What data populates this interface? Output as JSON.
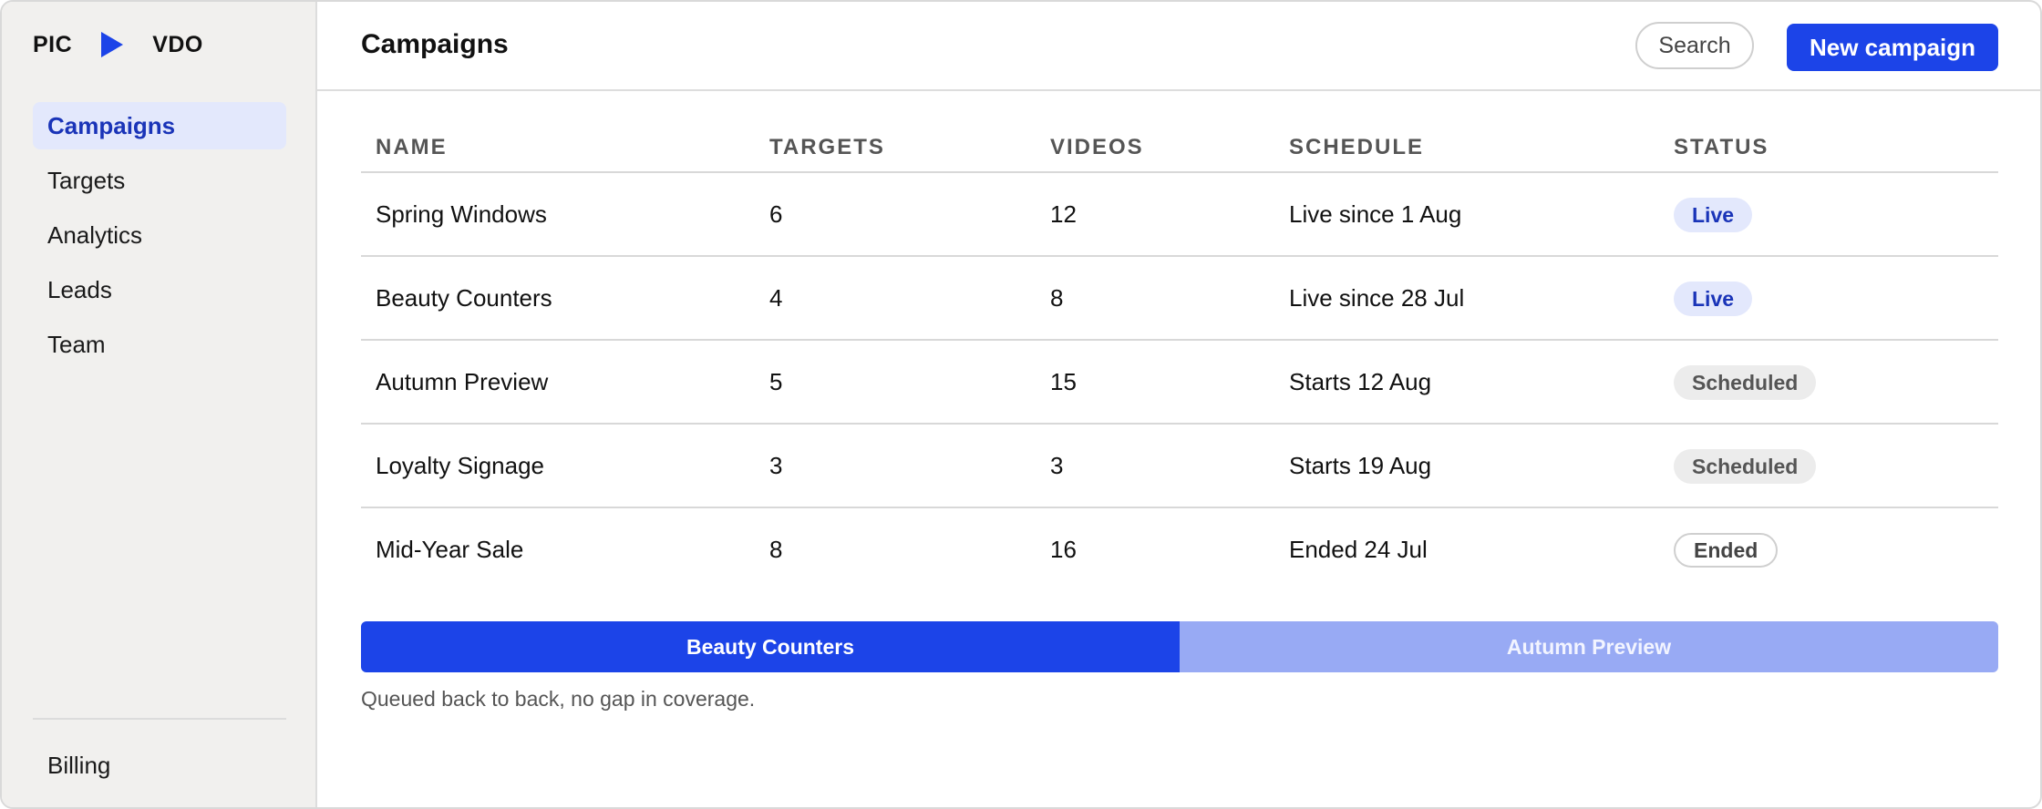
{
  "app": {
    "logo_left": "PIC",
    "logo_right": "VDO"
  },
  "sidebar": {
    "items": [
      {
        "label": "Campaigns",
        "active": true
      },
      {
        "label": "Targets"
      },
      {
        "label": "Analytics"
      },
      {
        "label": "Leads"
      },
      {
        "label": "Team"
      }
    ],
    "footer_item": "Billing"
  },
  "header": {
    "title": "Campaigns",
    "search_label": "Search",
    "new_label": "New campaign"
  },
  "table": {
    "columns": [
      "NAME",
      "TARGETS",
      "VIDEOS",
      "SCHEDULE",
      "STATUS"
    ],
    "rows": [
      {
        "name": "Spring Windows",
        "targets": "6",
        "videos": "12",
        "schedule": "Live since 1 Aug",
        "status": "Live",
        "status_kind": "live"
      },
      {
        "name": "Beauty Counters",
        "targets": "4",
        "videos": "8",
        "schedule": "Live since 28 Jul",
        "status": "Live",
        "status_kind": "live"
      },
      {
        "name": "Autumn Preview",
        "targets": "5",
        "videos": "15",
        "schedule": "Starts 12 Aug",
        "status": "Scheduled",
        "status_kind": "scheduled"
      },
      {
        "name": "Loyalty Signage",
        "targets": "3",
        "videos": "3",
        "schedule": "Starts 19 Aug",
        "status": "Scheduled",
        "status_kind": "scheduled"
      },
      {
        "name": "Mid-Year Sale",
        "targets": "8",
        "videos": "16",
        "schedule": "Ended 24 Jul",
        "status": "Ended",
        "status_kind": "ended"
      }
    ]
  },
  "queue": {
    "segments": [
      "Beauty Counters",
      "Autumn Preview"
    ],
    "note": "Queued back to back, no gap in coverage."
  },
  "colors": {
    "accent": "#1c44e8",
    "accent_light": "#98aaf4",
    "active_bg": "#e3e8fc"
  }
}
